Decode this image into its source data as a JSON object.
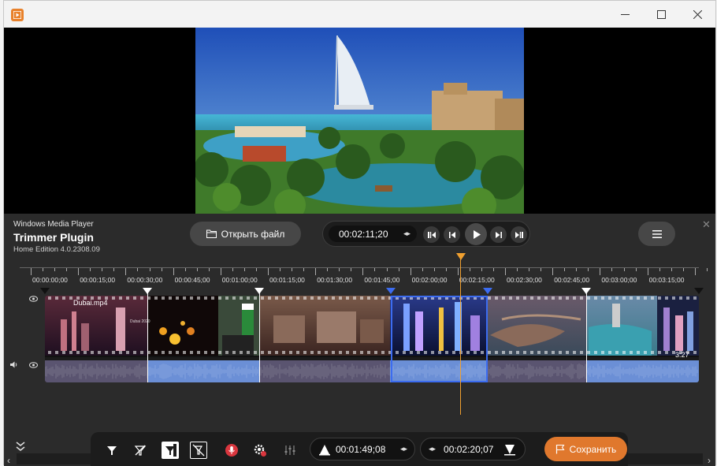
{
  "window": {
    "minimize": "—",
    "maximize": "☐",
    "close": "✕"
  },
  "brand": {
    "line1": "Windows Media Player",
    "line2": "Trimmer Plugin",
    "line3": "Home Edition 4.0.2308.09"
  },
  "toolbar": {
    "open_file_label": "Открыть файл",
    "current_time": "00:02:11;20"
  },
  "ruler": {
    "labels": [
      "00:00:00;00",
      "00:00:15;00",
      "00:00:30;00",
      "00:00:45;00",
      "00:01:00;00",
      "00:01:15;00",
      "00:01:30;00",
      "00:01:45;00",
      "00:02:00;00",
      "00:02:15;00",
      "00:02:30;00",
      "00:02:45;00",
      "00:03:00;00",
      "00:03:15;00"
    ]
  },
  "track": {
    "filename": "Dubai.mp4",
    "duration": "3:27",
    "small_label": "Dubai 2020"
  },
  "bottom": {
    "start_time": "00:01:49;08",
    "end_time": "00:02:20;07",
    "save_label": "Сохранить"
  },
  "colors": {
    "accent": "#e0782d",
    "playhead": "#f0a030",
    "selection": "#3c6cf0",
    "wave": "#6b8fd6",
    "wave_dim": "#5a5470"
  },
  "icons": [
    "app-icon",
    "folder-icon",
    "prev-segment-icon",
    "step-back-icon",
    "play-icon",
    "step-forward-icon",
    "next-segment-icon",
    "hamburger-icon",
    "eye-icon",
    "speaker-icon",
    "filter-icon",
    "filter-off-icon",
    "filter-frame-icon",
    "delete-frame-icon",
    "mic-icon",
    "gear-icon",
    "equalizer-icon",
    "mark-in-icon",
    "mark-out-icon",
    "flag-icon",
    "collapse-icon"
  ]
}
